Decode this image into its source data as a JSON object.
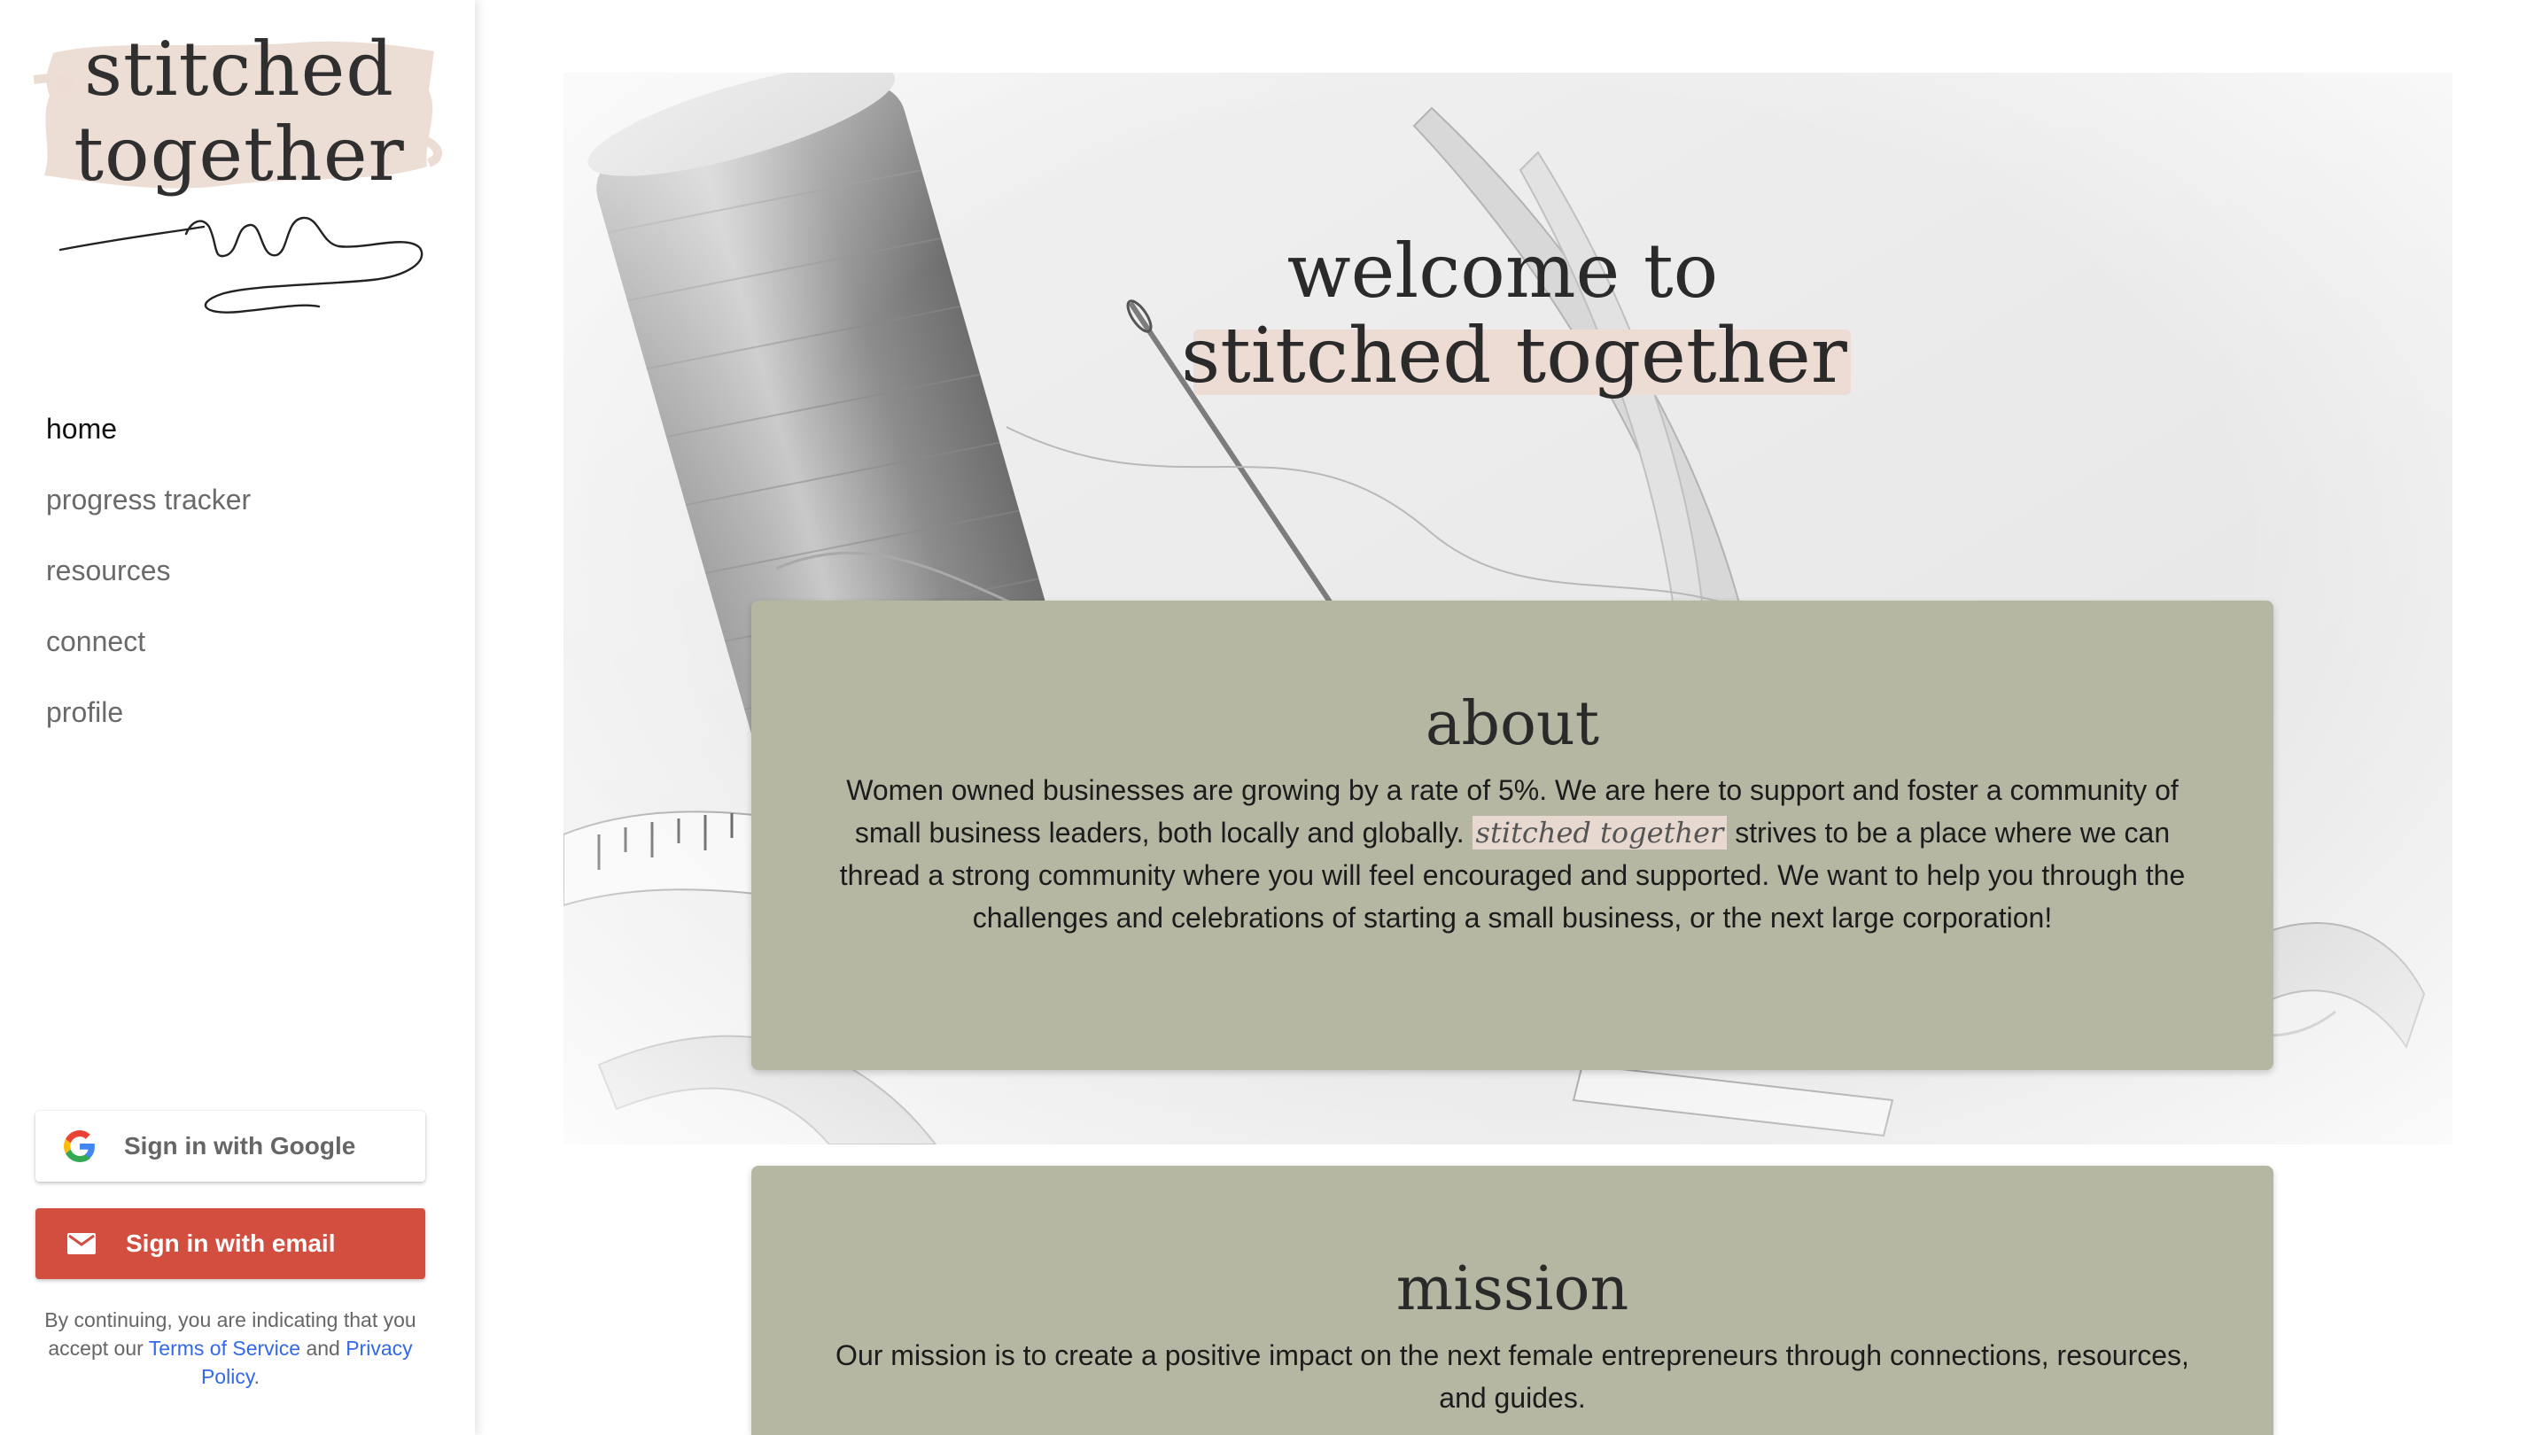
{
  "brand": {
    "name_line1": "stitched",
    "name_line2": "together",
    "accent_color": "#ecdcd3"
  },
  "nav": {
    "items": [
      {
        "label": "home",
        "active": true
      },
      {
        "label": "progress tracker",
        "active": false
      },
      {
        "label": "resources",
        "active": false
      },
      {
        "label": "connect",
        "active": false
      },
      {
        "label": "profile",
        "active": false
      }
    ]
  },
  "auth": {
    "google_label": "Sign in with Google",
    "email_label": "Sign in with email",
    "email_button_color": "#d24f40",
    "disclaimer_prefix": "By continuing, you are indicating that you accept our",
    "terms_link": "Terms of Service",
    "and": "and",
    "privacy_link": "Privacy Policy",
    "period": "."
  },
  "hero": {
    "line1": "welcome to",
    "line2": "stitched together"
  },
  "about": {
    "title": "about",
    "text_before": "Women owned businesses are growing by a rate of 5%. We are here to support and foster a community of small business leaders, both locally and globally.",
    "brand_inline": "stitched together",
    "text_after": "strives to be a place where we can thread a strong community where you will feel encouraged and supported. We want to help you through the challenges and celebrations of starting a small business, or the next large corporation!",
    "card_color": "#b6b7a2"
  },
  "mission": {
    "title": "mission",
    "text": "Our mission is to create a positive impact on the next female entrepreneurs through connections, resources, and guides."
  }
}
